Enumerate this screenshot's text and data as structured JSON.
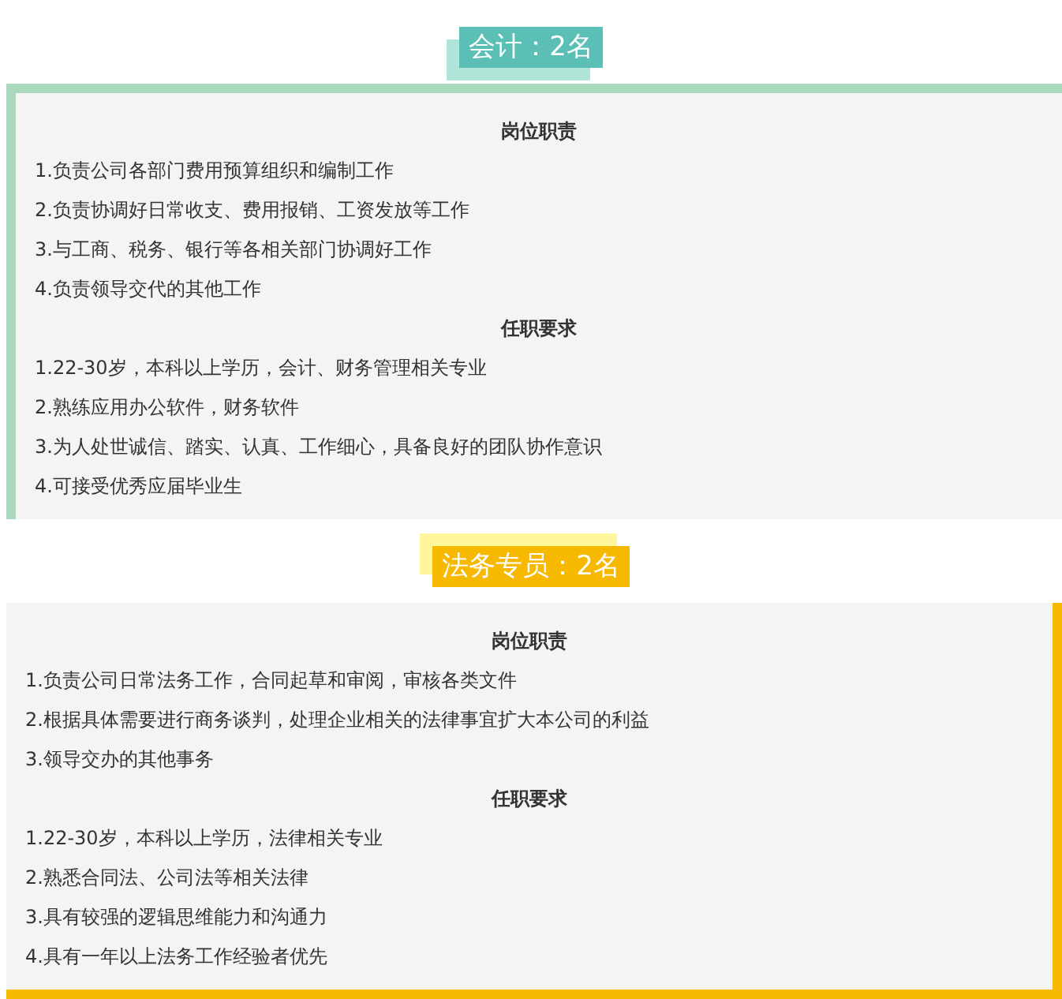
{
  "positions": [
    {
      "kind": "green",
      "title": "会计：2名",
      "sections": [
        {
          "heading": "岗位职责",
          "items": [
            "1.负责公司各部门费用预算组织和编制工作",
            "2.负责协调好日常收支、费用报销、工资发放等工作",
            "3.与工商、税务、银行等各相关部门协调好工作",
            "4.负责领导交代的其他工作"
          ]
        },
        {
          "heading": "任职要求",
          "items": [
            "1.22-30岁，本科以上学历，会计、财务管理相关专业",
            "2.熟练应用办公软件，财务软件",
            "3.为人处世诚信、踏实、认真、工作细心，具备良好的团队协作意识",
            "4.可接受优秀应届毕业生"
          ]
        }
      ]
    },
    {
      "kind": "yellow",
      "title": "法务专员：2名",
      "sections": [
        {
          "heading": "岗位职责",
          "items": [
            "1.负责公司日常法务工作，合同起草和审阅，审核各类文件",
            "2.根据具体需要进行商务谈判，处理企业相关的法律事宜扩大本公司的利益",
            "3.领导交办的其他事务"
          ]
        },
        {
          "heading": "任职要求",
          "items": [
            "1.22-30岁，本科以上学历，法律相关专业",
            "2.熟悉合同法、公司法等相关法律",
            "3.具有较强的逻辑思维能力和沟通力",
            "4.具有一年以上法务工作经验者优先"
          ]
        }
      ]
    }
  ]
}
